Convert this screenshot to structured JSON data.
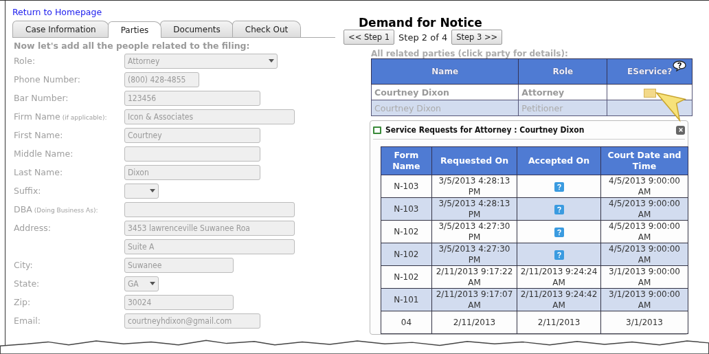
{
  "home_link": "Return to Homepage",
  "tabs": [
    {
      "label": "Case Information",
      "selected": false
    },
    {
      "label": "Parties",
      "selected": true
    },
    {
      "label": "Documents",
      "selected": false
    },
    {
      "label": "Check Out",
      "selected": false
    }
  ],
  "form": {
    "heading": "Now let's add all the people related to the filing:",
    "fields": [
      {
        "label": "Role:",
        "kind": "select",
        "value": "Attorney"
      },
      {
        "label": "Phone Number:",
        "kind": "text",
        "value": "(800) 428-4855"
      },
      {
        "label": "Bar Number:",
        "kind": "text",
        "value": "123456"
      },
      {
        "label": "Firm Name",
        "note": "(if applicable):",
        "kind": "text",
        "value": "Icon & Associates"
      },
      {
        "label": "First Name:",
        "kind": "text",
        "value": "Courtney"
      },
      {
        "label": "Middle Name:",
        "kind": "text"
      },
      {
        "label": "Last Name:",
        "kind": "text",
        "value": "Dixon"
      },
      {
        "label": "Suffix:",
        "kind": "select"
      },
      {
        "label": "DBA",
        "note": "(Doing Business As):",
        "kind": "text"
      },
      {
        "label": "Address:",
        "kind": "text",
        "value": "3453 lawrenceville Suwanee Roa"
      },
      {
        "kind": "text",
        "value": "Suite A"
      },
      {
        "label": "City:",
        "kind": "text",
        "value": "Suwanee"
      },
      {
        "label": "State:",
        "kind": "select",
        "value": "GA"
      },
      {
        "label": "Zip:",
        "kind": "text",
        "value": "30024"
      },
      {
        "label": "Email:",
        "kind": "text",
        "value": "courtneyhdixon@gmail.com"
      }
    ]
  },
  "title": "Demand for Notice",
  "steps": {
    "prev": "<< Step 1",
    "current": "Step 2 of 4",
    "next": "Step 3 >>"
  },
  "parties": {
    "caption": "All related parties (click party for details):",
    "columns": [
      "Name",
      "Role",
      "EService?"
    ],
    "rows": [
      {
        "name": "Courtney Dixon",
        "role": "Attorney",
        "eservice": true,
        "selected": true
      },
      {
        "name": "Courtney Dixon",
        "role": "Petitioner",
        "eservice": false,
        "selected": false
      }
    ]
  },
  "dialog": {
    "title": "Service Requests for Attorney : Courtney Dixon",
    "columns": [
      "Form Name",
      "Requested On",
      "Accepted On",
      "Court Date and Time"
    ],
    "rows": [
      {
        "form": "N-103",
        "requested": "3/5/2013 4:28:13 PM",
        "court": "4/5/2013 9:00:00 AM"
      },
      {
        "form": "N-103",
        "requested": "3/5/2013 4:28:13 PM",
        "court": "4/5/2013 9:00:00 AM"
      },
      {
        "form": "N-102",
        "requested": "3/5/2013 4:27:30 PM",
        "court": "4/5/2013 9:00:00 AM"
      },
      {
        "form": "N-102",
        "requested": "3/5/2013 4:27:30 PM",
        "court": "4/5/2013 9:00:00 AM"
      },
      {
        "form": "N-102",
        "requested": "2/11/2013 9:17:22 AM",
        "accepted": "2/11/2013 9:24:24 AM",
        "court": "3/1/2013 9:00:00 AM"
      },
      {
        "form": "N-101",
        "requested": "2/11/2013 9:17:07 AM",
        "accepted": "2/11/2013 9:24:42 AM",
        "court": "3/1/2013 9:00:00 AM"
      },
      {
        "form": "04",
        "requested": "2/11/2013",
        "accepted": "2/11/2013",
        "court": "3/1/2013"
      }
    ]
  }
}
